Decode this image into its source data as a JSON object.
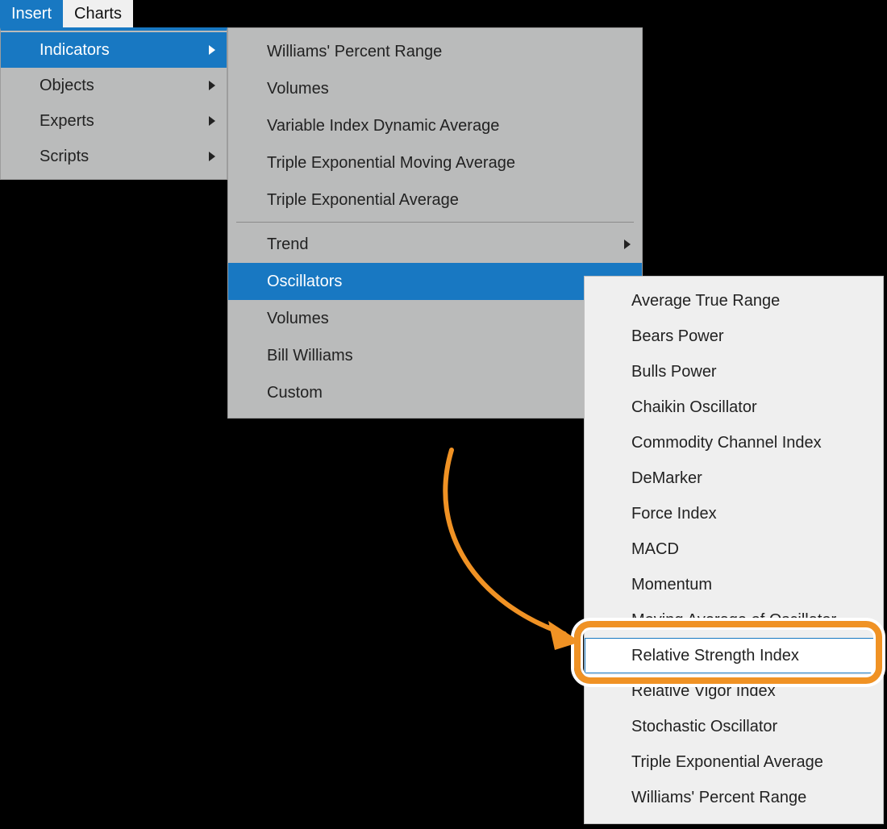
{
  "menubar": {
    "insert": "Insert",
    "charts": "Charts"
  },
  "insert_menu": {
    "items": [
      {
        "label": "Indicators",
        "has_submenu": true,
        "selected": true
      },
      {
        "label": "Objects",
        "has_submenu": true,
        "selected": false
      },
      {
        "label": "Experts",
        "has_submenu": true,
        "selected": false
      },
      {
        "label": "Scripts",
        "has_submenu": true,
        "selected": false
      }
    ]
  },
  "indicators_menu": {
    "top_items": [
      "Williams' Percent Range",
      "Volumes",
      "Variable Index Dynamic Average",
      "Triple Exponential Moving Average",
      "Triple Exponential Average"
    ],
    "bottom_items": [
      {
        "label": "Trend",
        "has_submenu": true,
        "selected": false
      },
      {
        "label": "Oscillators",
        "has_submenu": false,
        "selected": true
      },
      {
        "label": "Volumes",
        "has_submenu": false,
        "selected": false
      },
      {
        "label": "Bill Williams",
        "has_submenu": false,
        "selected": false
      },
      {
        "label": "Custom",
        "has_submenu": false,
        "selected": false
      }
    ]
  },
  "oscillators_menu": {
    "items": [
      "Average True Range",
      "Bears Power",
      "Bulls Power",
      "Chaikin Oscillator",
      "Commodity Channel Index",
      "DeMarker",
      "Force Index",
      "MACD",
      "Momentum",
      "Moving Average of Oscillator",
      "Relative Strength Index",
      "Relative Vigor Index",
      "Stochastic Oscillator",
      "Triple Exponential Average",
      "Williams' Percent Range"
    ],
    "hover_index": 10
  },
  "annotation": {
    "highlighted_item": "Relative Strength Index",
    "arrow_color": "#f09224"
  }
}
